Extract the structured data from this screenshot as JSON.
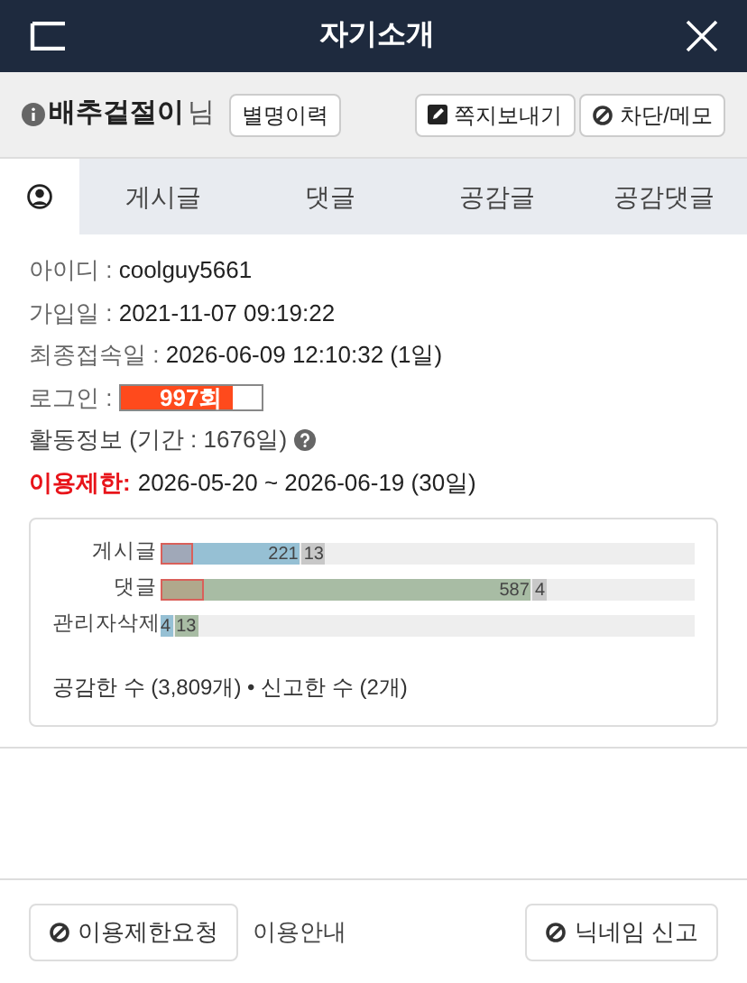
{
  "header": {
    "title": "자기소개"
  },
  "user": {
    "nickname": "배추겉절이",
    "suffix": "님",
    "buttons": [
      {
        "kind": "history",
        "label": "별명이력"
      },
      {
        "kind": "message",
        "label": "쪽지보내기"
      },
      {
        "kind": "block",
        "label": "차단/메모"
      }
    ]
  },
  "tabs": [
    {
      "kind": "icon",
      "selected": true
    },
    {
      "label": "게시글",
      "selected": false
    },
    {
      "label": "댓글",
      "selected": false
    },
    {
      "label": "공감글",
      "selected": false
    },
    {
      "label": "공감댓글",
      "selected": false
    }
  ],
  "info": [
    {
      "kind": "text",
      "label": "아이디 : ",
      "value": "coolguy5661"
    },
    {
      "kind": "text",
      "label": "가입일 : ",
      "value": "2021-11-07 09:19:22"
    },
    {
      "kind": "text",
      "label": "최종접속일 : ",
      "value": "2026-06-09 12:10:32 (1일)"
    },
    {
      "kind": "meter",
      "label": "로그인 : ",
      "value": "997회",
      "level": 0.8
    },
    {
      "kind": "help",
      "label": "활동정보 (기간 : 1676일)"
    },
    {
      "kind": "alert",
      "label": "이용제한:",
      "value": "2026-05-20 ~ 2026-06-19 (30일)"
    }
  ],
  "stats": {
    "rows": [
      {
        "label": "게시글",
        "bar": {
          "color": "#96c0d4",
          "label": "221",
          "flag": {
            "color": "#a0a8b8",
            "level": 0.23
          }
        },
        "tails": [
          {
            "color": "#c8c8c8",
            "label": "13"
          }
        ]
      },
      {
        "label": "댓글",
        "bar": {
          "color": "#a8bca4",
          "label": "587",
          "flag": {
            "color": "#b0a88c",
            "level": 0.115
          }
        },
        "tails": [
          {
            "color": "#c8c8c8",
            "label": "4"
          }
        ]
      },
      {
        "label": "관리자삭제",
        "bar": {
          "color": "#96c0d4",
          "label": "4"
        },
        "tails": [
          {
            "color": "#a8bca4",
            "label": "13"
          }
        ]
      }
    ],
    "summary": "공감한 수 (3,809개) • 신고한 수 (2개)"
  },
  "footer": {
    "left_button": "이용제한요청",
    "link": "이용안내",
    "right_button": "닉네임 신고"
  }
}
